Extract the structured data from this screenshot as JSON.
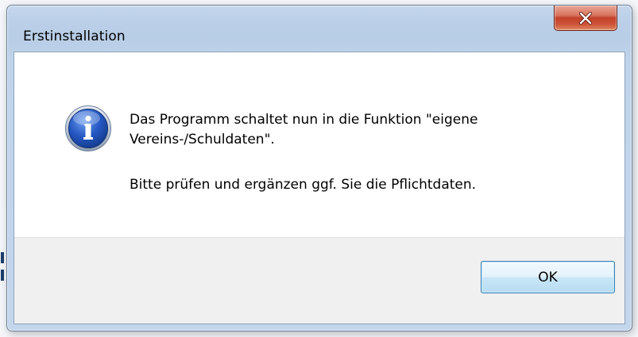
{
  "window": {
    "title": "Erstinstallation",
    "close_icon": "close-icon"
  },
  "dialog": {
    "icon": "info-icon",
    "message_line_1": "Das Programm schaltet nun in die Funktion \"eigene",
    "message_line_2": "Vereins-/Schuldaten\".",
    "message_line_3": "Bitte prüfen und ergänzen ggf. Sie die Pflichtdaten."
  },
  "buttons": {
    "ok_label": "OK"
  },
  "colors": {
    "title_bar": "#bfd3ea",
    "close_button": "#c4412a",
    "footer": "#f0f0f0",
    "ok_border": "#3c7fb1",
    "info_icon": "#1f4fa8"
  }
}
